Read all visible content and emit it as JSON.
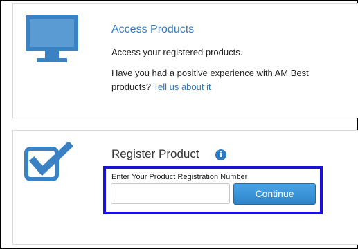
{
  "colors": {
    "brand_blue": "#2f7bbf",
    "highlight_border": "#1a12d6",
    "card_border": "#d9d9d9"
  },
  "access": {
    "icon": "monitor-icon",
    "title": "Access Products",
    "description": "Access your registered products.",
    "feedback_text": "Have you had a positive experience with AM Best products?",
    "feedback_link": "Tell us about it"
  },
  "register": {
    "icon": "checkbox-icon",
    "title": "Register Product",
    "info_icon": "info-icon",
    "info_glyph": "i",
    "field_label": "Enter Your Product Registration Number",
    "input_value": "",
    "continue_label": "Continue"
  }
}
